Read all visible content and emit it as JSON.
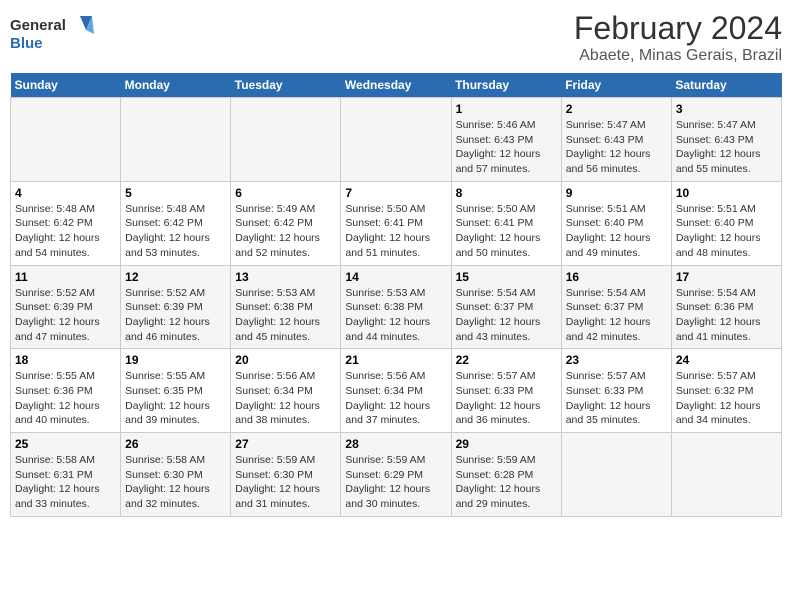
{
  "header": {
    "logo_line1": "General",
    "logo_line2": "Blue",
    "main_title": "February 2024",
    "sub_title": "Abaete, Minas Gerais, Brazil"
  },
  "days_of_week": [
    "Sunday",
    "Monday",
    "Tuesday",
    "Wednesday",
    "Thursday",
    "Friday",
    "Saturday"
  ],
  "weeks": [
    [
      {
        "day": "",
        "info": ""
      },
      {
        "day": "",
        "info": ""
      },
      {
        "day": "",
        "info": ""
      },
      {
        "day": "",
        "info": ""
      },
      {
        "day": "1",
        "info": "Sunrise: 5:46 AM\nSunset: 6:43 PM\nDaylight: 12 hours\nand 57 minutes."
      },
      {
        "day": "2",
        "info": "Sunrise: 5:47 AM\nSunset: 6:43 PM\nDaylight: 12 hours\nand 56 minutes."
      },
      {
        "day": "3",
        "info": "Sunrise: 5:47 AM\nSunset: 6:43 PM\nDaylight: 12 hours\nand 55 minutes."
      }
    ],
    [
      {
        "day": "4",
        "info": "Sunrise: 5:48 AM\nSunset: 6:42 PM\nDaylight: 12 hours\nand 54 minutes."
      },
      {
        "day": "5",
        "info": "Sunrise: 5:48 AM\nSunset: 6:42 PM\nDaylight: 12 hours\nand 53 minutes."
      },
      {
        "day": "6",
        "info": "Sunrise: 5:49 AM\nSunset: 6:42 PM\nDaylight: 12 hours\nand 52 minutes."
      },
      {
        "day": "7",
        "info": "Sunrise: 5:50 AM\nSunset: 6:41 PM\nDaylight: 12 hours\nand 51 minutes."
      },
      {
        "day": "8",
        "info": "Sunrise: 5:50 AM\nSunset: 6:41 PM\nDaylight: 12 hours\nand 50 minutes."
      },
      {
        "day": "9",
        "info": "Sunrise: 5:51 AM\nSunset: 6:40 PM\nDaylight: 12 hours\nand 49 minutes."
      },
      {
        "day": "10",
        "info": "Sunrise: 5:51 AM\nSunset: 6:40 PM\nDaylight: 12 hours\nand 48 minutes."
      }
    ],
    [
      {
        "day": "11",
        "info": "Sunrise: 5:52 AM\nSunset: 6:39 PM\nDaylight: 12 hours\nand 47 minutes."
      },
      {
        "day": "12",
        "info": "Sunrise: 5:52 AM\nSunset: 6:39 PM\nDaylight: 12 hours\nand 46 minutes."
      },
      {
        "day": "13",
        "info": "Sunrise: 5:53 AM\nSunset: 6:38 PM\nDaylight: 12 hours\nand 45 minutes."
      },
      {
        "day": "14",
        "info": "Sunrise: 5:53 AM\nSunset: 6:38 PM\nDaylight: 12 hours\nand 44 minutes."
      },
      {
        "day": "15",
        "info": "Sunrise: 5:54 AM\nSunset: 6:37 PM\nDaylight: 12 hours\nand 43 minutes."
      },
      {
        "day": "16",
        "info": "Sunrise: 5:54 AM\nSunset: 6:37 PM\nDaylight: 12 hours\nand 42 minutes."
      },
      {
        "day": "17",
        "info": "Sunrise: 5:54 AM\nSunset: 6:36 PM\nDaylight: 12 hours\nand 41 minutes."
      }
    ],
    [
      {
        "day": "18",
        "info": "Sunrise: 5:55 AM\nSunset: 6:36 PM\nDaylight: 12 hours\nand 40 minutes."
      },
      {
        "day": "19",
        "info": "Sunrise: 5:55 AM\nSunset: 6:35 PM\nDaylight: 12 hours\nand 39 minutes."
      },
      {
        "day": "20",
        "info": "Sunrise: 5:56 AM\nSunset: 6:34 PM\nDaylight: 12 hours\nand 38 minutes."
      },
      {
        "day": "21",
        "info": "Sunrise: 5:56 AM\nSunset: 6:34 PM\nDaylight: 12 hours\nand 37 minutes."
      },
      {
        "day": "22",
        "info": "Sunrise: 5:57 AM\nSunset: 6:33 PM\nDaylight: 12 hours\nand 36 minutes."
      },
      {
        "day": "23",
        "info": "Sunrise: 5:57 AM\nSunset: 6:33 PM\nDaylight: 12 hours\nand 35 minutes."
      },
      {
        "day": "24",
        "info": "Sunrise: 5:57 AM\nSunset: 6:32 PM\nDaylight: 12 hours\nand 34 minutes."
      }
    ],
    [
      {
        "day": "25",
        "info": "Sunrise: 5:58 AM\nSunset: 6:31 PM\nDaylight: 12 hours\nand 33 minutes."
      },
      {
        "day": "26",
        "info": "Sunrise: 5:58 AM\nSunset: 6:30 PM\nDaylight: 12 hours\nand 32 minutes."
      },
      {
        "day": "27",
        "info": "Sunrise: 5:59 AM\nSunset: 6:30 PM\nDaylight: 12 hours\nand 31 minutes."
      },
      {
        "day": "28",
        "info": "Sunrise: 5:59 AM\nSunset: 6:29 PM\nDaylight: 12 hours\nand 30 minutes."
      },
      {
        "day": "29",
        "info": "Sunrise: 5:59 AM\nSunset: 6:28 PM\nDaylight: 12 hours\nand 29 minutes."
      },
      {
        "day": "",
        "info": ""
      },
      {
        "day": "",
        "info": ""
      }
    ]
  ]
}
